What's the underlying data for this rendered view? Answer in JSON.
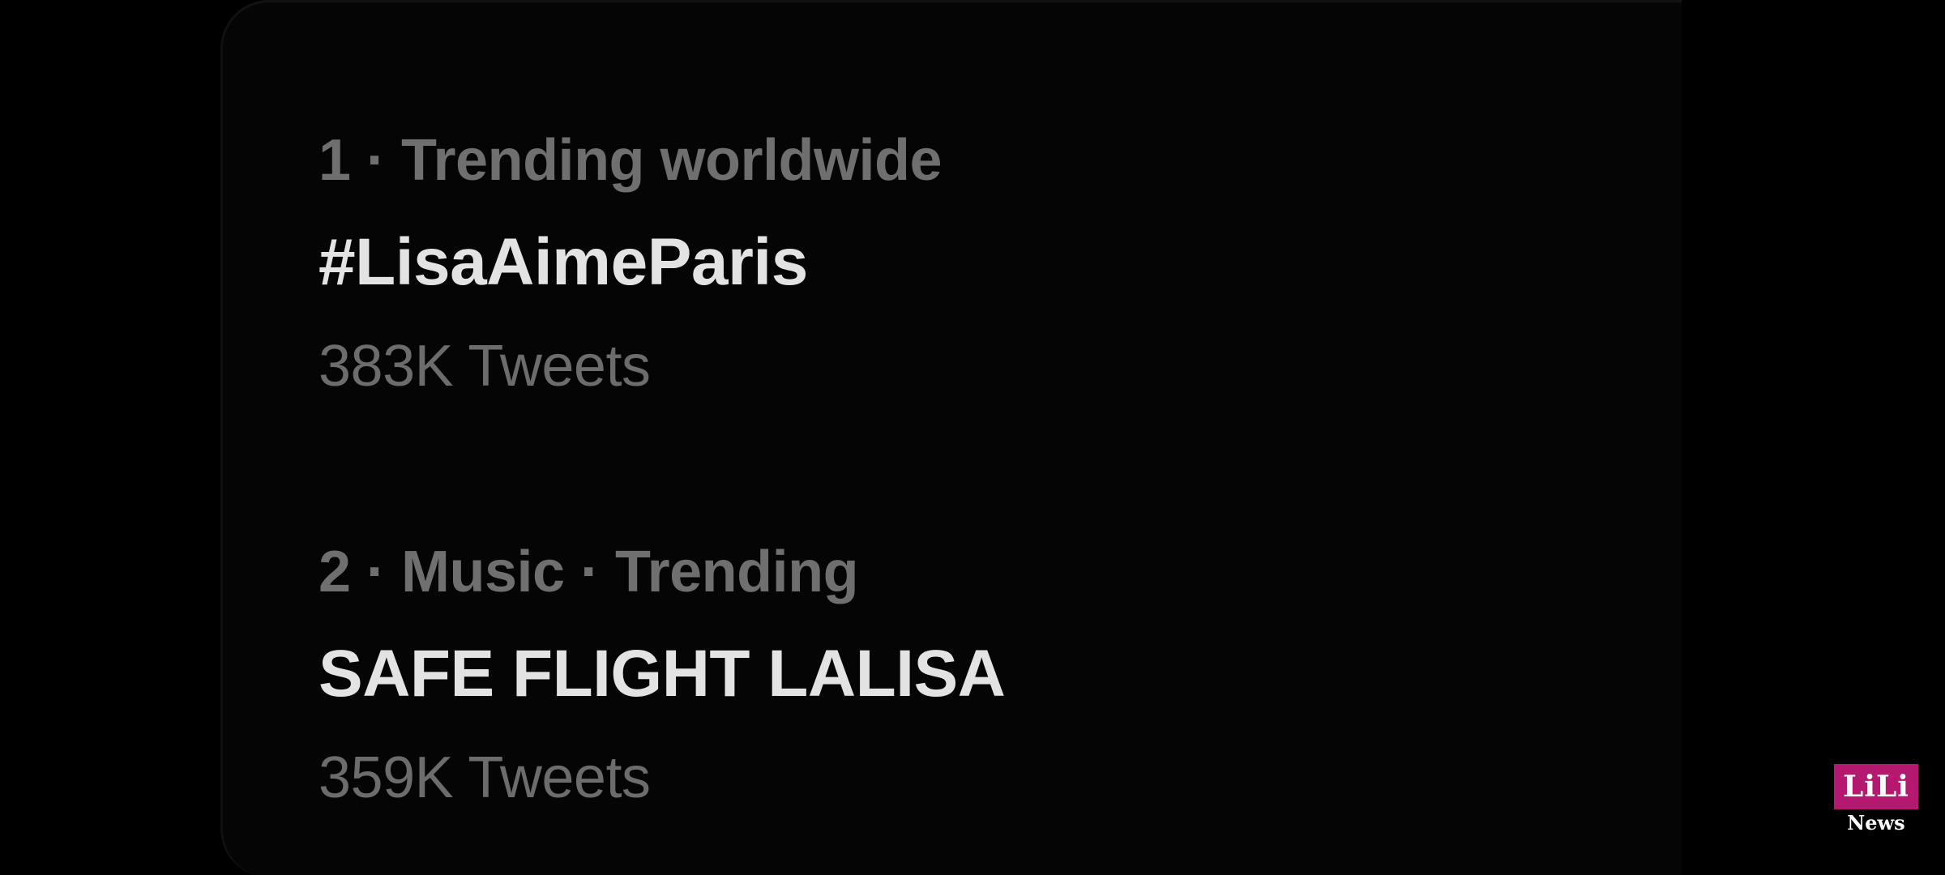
{
  "trends": [
    {
      "meta": "1 · Trending worldwide",
      "title": "#LisaAimeParis",
      "count": "383K Tweets"
    },
    {
      "meta": "2 · Music · Trending",
      "title": "SAFE FLIGHT LALISA",
      "count": "359K Tweets"
    }
  ],
  "watermark": {
    "logo": "LiLi",
    "sub": "News"
  },
  "colors": {
    "background": "#000000",
    "primary_text": "#e3e3e3",
    "secondary_text": "#6f6f6f",
    "watermark_accent": "#b4196f"
  }
}
